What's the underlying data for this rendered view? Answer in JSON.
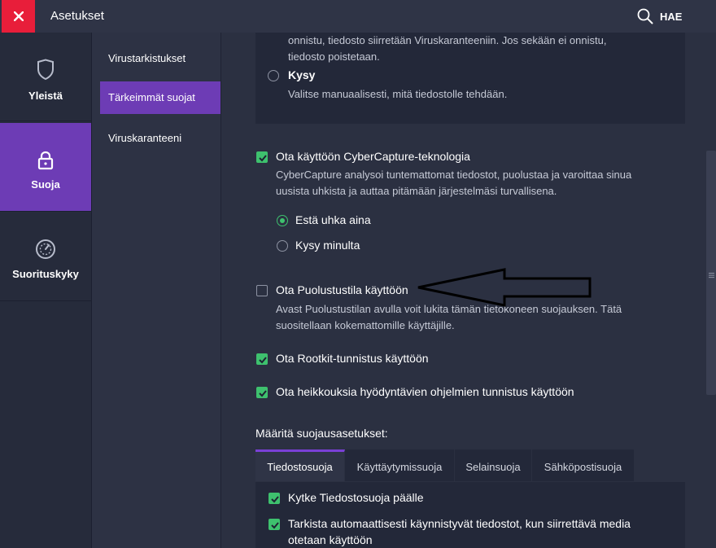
{
  "window": {
    "title": "Asetukset",
    "search_label": "HAE"
  },
  "sidebar": {
    "items": [
      {
        "label": "Yleistä",
        "icon": "shield-icon"
      },
      {
        "label": "Suoja",
        "icon": "lock-icon",
        "active": true
      },
      {
        "label": "Suorituskyky",
        "icon": "speedometer-icon"
      }
    ]
  },
  "subnav": {
    "items": [
      {
        "label": "Virustarkistukset"
      },
      {
        "label": "Tärkeimmät suojat",
        "active": true
      },
      {
        "label": "Viruskaranteeni"
      }
    ]
  },
  "top_panel": {
    "partial_text_line1": "onnistu, tiedosto siirretään Viruskaranteeniin. Jos sekään ei onnistu,",
    "partial_text_line2": "tiedosto poistetaan.",
    "ask_label": "Kysy",
    "ask_desc": "Valitse manuaalisesti, mitä tiedostolle tehdään."
  },
  "cybercapture": {
    "label": "Ota käyttöön CyberCapture-teknologia",
    "desc_line1": "CyberCapture analysoi tuntemattomat tiedostot, puolustaa ja varoittaa sinua",
    "desc_line2": "uusista uhkista ja auttaa pitämään järjestelmäsi turvallisena.",
    "checked": true,
    "options": [
      {
        "label": "Estä uhka aina",
        "selected": true
      },
      {
        "label": "Kysy minulta",
        "selected": false
      }
    ]
  },
  "hardened_mode": {
    "label": "Ota Puolustustila käyttöön",
    "desc_line1": "Avast Puolustustilan avulla voit lukita tämän tietokoneen suojauksen. Tätä",
    "desc_line2": "suositellaan kokemattomille käyttäjille.",
    "checked": false
  },
  "rootkit": {
    "label": "Ota Rootkit-tunnistus käyttöön",
    "checked": true
  },
  "exploit": {
    "label": "Ota heikkouksia hyödyntävien ohjelmien tunnistus käyttöön",
    "checked": true
  },
  "shields": {
    "heading": "Määritä suojausasetukset:",
    "tabs": [
      {
        "label": "Tiedostosuoja",
        "active": true
      },
      {
        "label": "Käyttäytymissuoja"
      },
      {
        "label": "Selainsuoja"
      },
      {
        "label": "Sähköpostisuoja"
      }
    ],
    "options": [
      {
        "label": "Kytke Tiedostosuoja päälle",
        "checked": true
      },
      {
        "label_line1": "Tarkista automaattisesti käynnistyvät tiedostot, kun siirrettävä media",
        "label_line2": "otetaan käyttöön",
        "checked": true
      }
    ]
  },
  "colors": {
    "accent": "#6d3cb5",
    "close": "#e81e3a",
    "check": "#3ec16e",
    "bg": "#2b3041"
  }
}
